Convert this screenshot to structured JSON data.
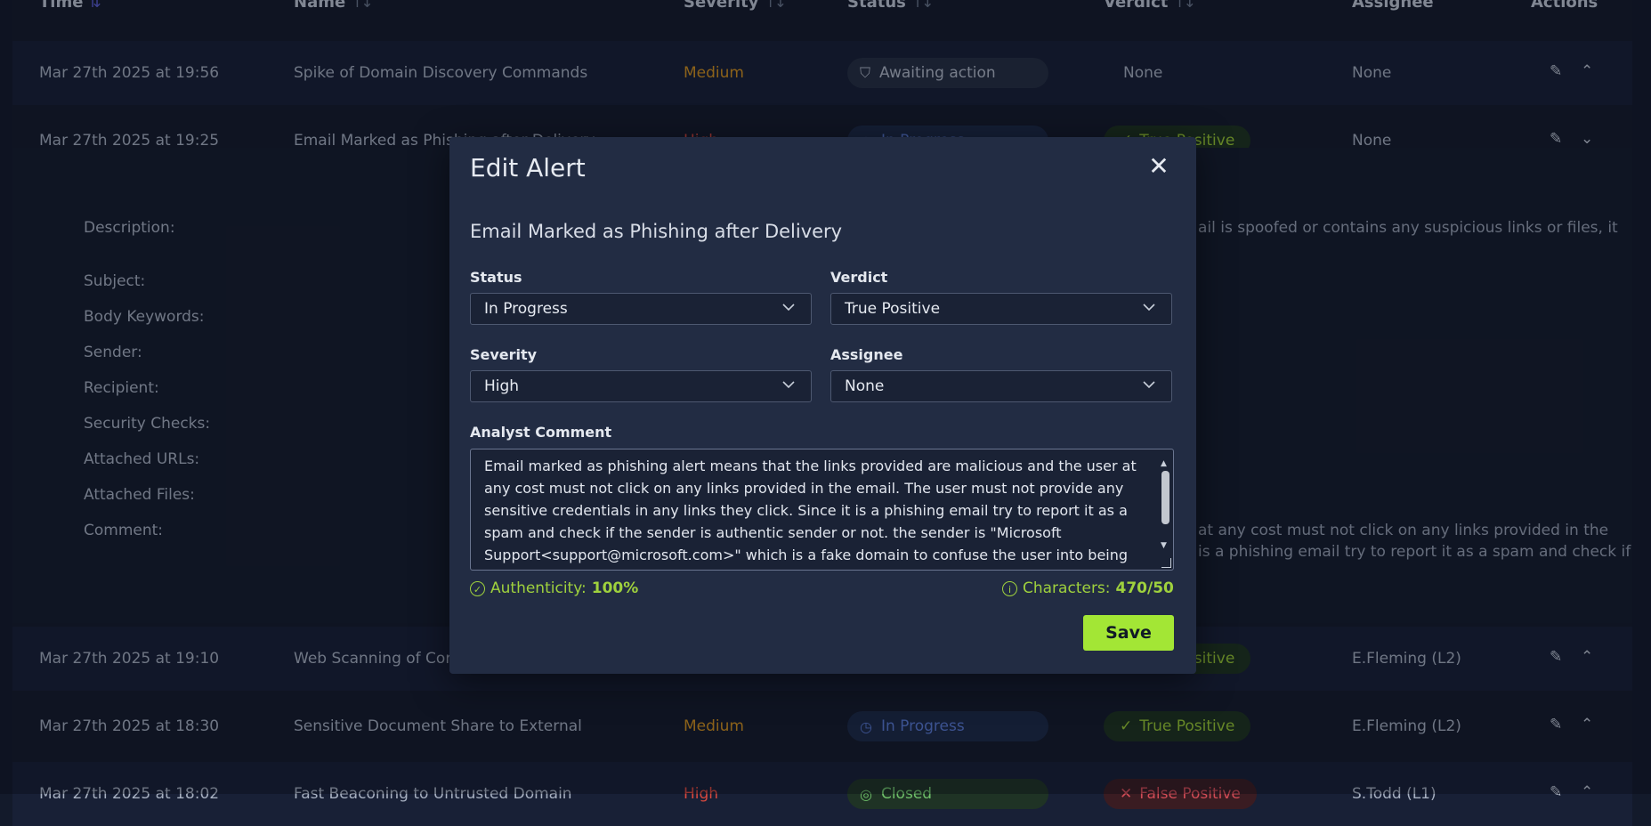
{
  "columns": {
    "time": "Time",
    "name": "Name",
    "severity": "Severity",
    "status": "Status",
    "verdict": "Verdict",
    "assignee": "Assignee",
    "actions": "Actions"
  },
  "rows": [
    {
      "time": "Mar 27th 2025 at 19:56",
      "name": "Spike of Domain Discovery Commands",
      "severity": "Medium",
      "status": "Awaiting action",
      "verdict": "None",
      "assignee": "None"
    },
    {
      "time": "Mar 27th 2025 at 19:25",
      "name": "Email Marked as Phishing after Delivery",
      "severity": "High",
      "status": "In Progress",
      "verdict": "True Positive",
      "assignee": "None"
    },
    {
      "time": "Mar 27th 2025 at 19:10",
      "name": "Web Scanning of Corp",
      "severity": "",
      "status": "",
      "verdict": "True Positive",
      "assignee": "E.Fleming (L2)"
    },
    {
      "time": "Mar 27th 2025 at 18:30",
      "name": "Sensitive Document Share to External",
      "severity": "Medium",
      "status": "In Progress",
      "verdict": "True Positive",
      "assignee": "E.Fleming (L2)"
    },
    {
      "time": "Mar 27th 2025 at 18:02",
      "name": "Fast Beaconing to Untrusted Domain",
      "severity": "High",
      "status": "Closed",
      "verdict": "False Positive",
      "assignee": "S.Todd (L1)"
    }
  ],
  "details": {
    "labels": [
      "Description:",
      "Subject:",
      "Body Keywords:",
      "Sender:",
      "Recipient:",
      "Security Checks:",
      "Attached URLs:",
      "Attached Files:",
      "Comment:"
    ],
    "description_fragment": "ail is spoofed or contains any suspicious links or files, it",
    "comment_fragment_1": "at any cost must not click on any links provided in the",
    "comment_fragment_2": "is a phishing email try to report it as a spam and check if"
  },
  "modal": {
    "title": "Edit Alert",
    "alert_name": "Email Marked as Phishing after Delivery",
    "status_label": "Status",
    "status_value": "In Progress",
    "verdict_label": "Verdict",
    "verdict_value": "True Positive",
    "severity_label": "Severity",
    "severity_value": "High",
    "assignee_label": "Assignee",
    "assignee_value": "None",
    "comment_label": "Analyst Comment",
    "comment_value": "Email marked as phishing alert means that the links provided are malicious and the user at any cost must not click on any links provided in the email. The user must not provide any sensitive credentials in any links they click. Since it is a phishing email try to report it as a spam and check if the sender is authentic sender or not. the sender is \"Microsoft Support<support@microsoft.com>\" which is a fake domain to confuse the user into being",
    "authenticity_label": "Authenticity:",
    "authenticity_value": "100%",
    "characters_label": "Characters:",
    "characters_value": "470/50",
    "save_label": "Save"
  },
  "colors": {
    "accent": "#a3e635",
    "medium": "#d4931f",
    "high": "#d9493f",
    "in_progress": "#5a7bd6",
    "true_positive": "#9acb33"
  }
}
